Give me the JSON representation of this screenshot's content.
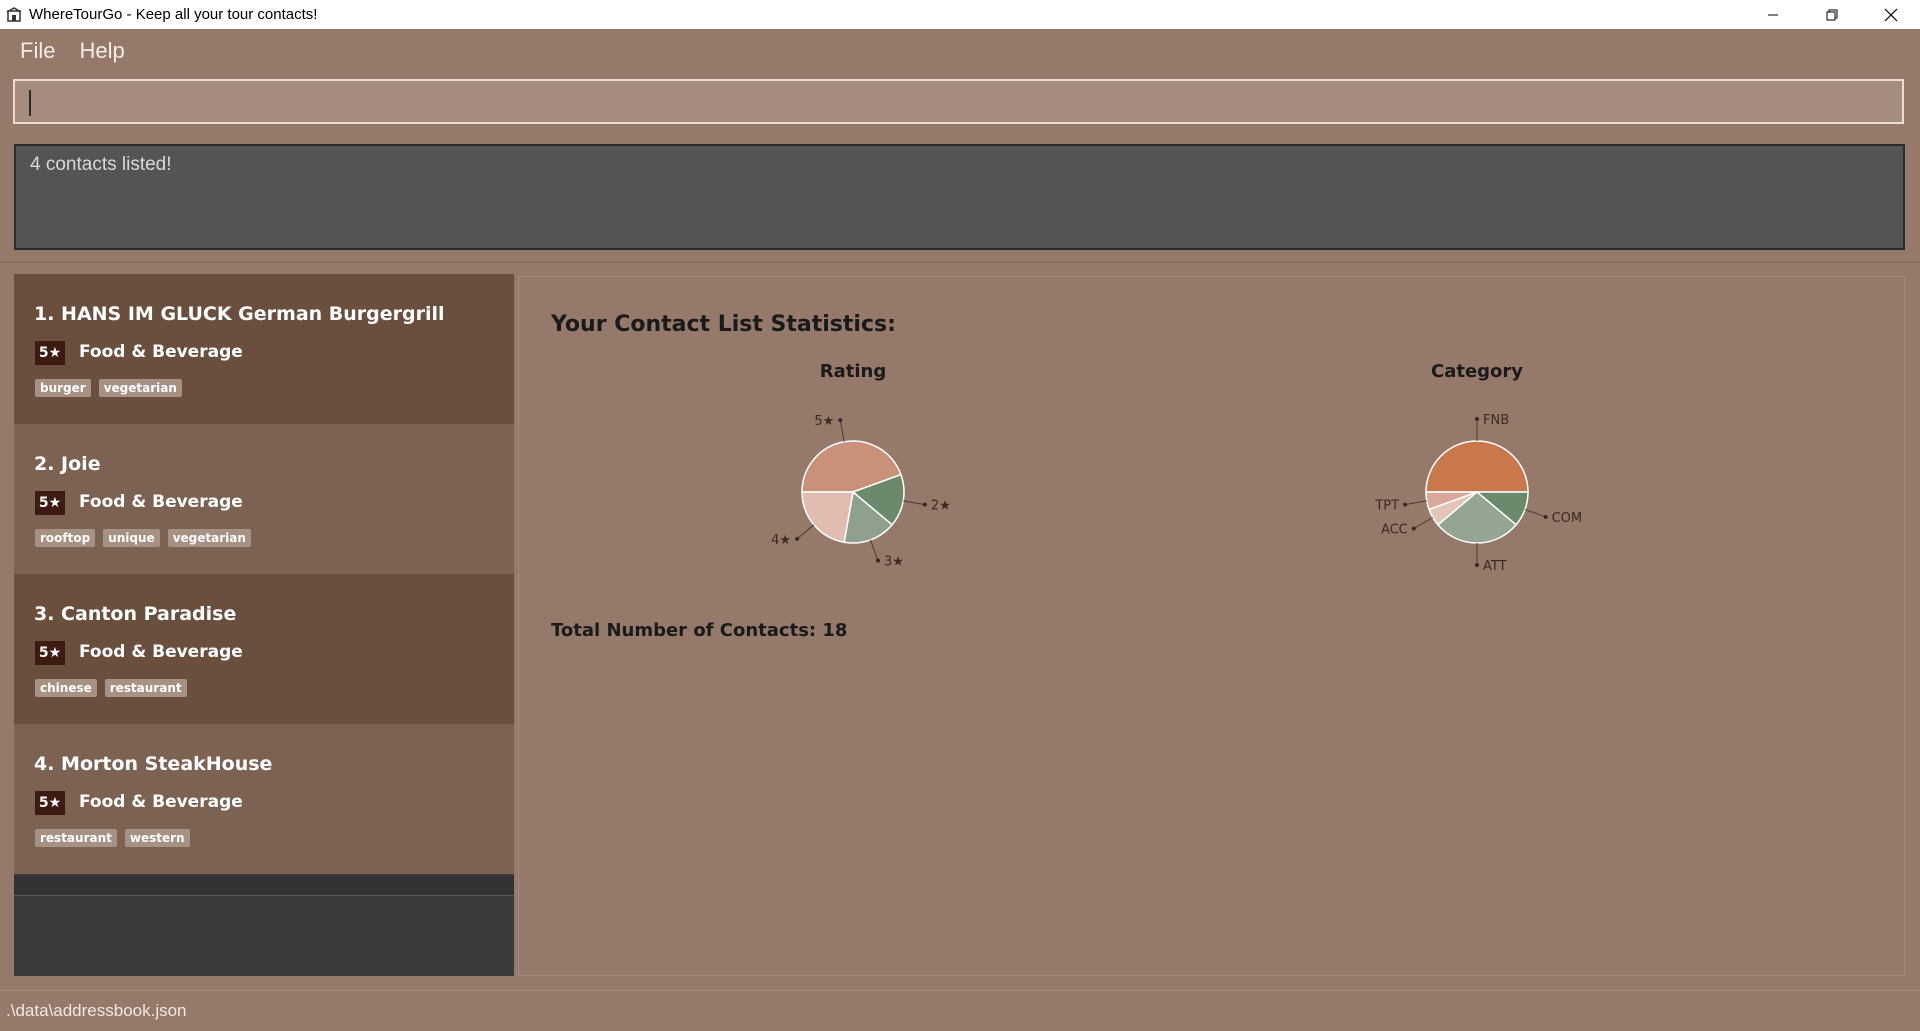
{
  "window": {
    "title": "WhereTourGo - Keep all your tour contacts!",
    "icons": {
      "app": "app-icon",
      "minimize": "minimize-icon",
      "maximize": "restore-icon",
      "close": "close-icon"
    }
  },
  "menu": {
    "file": "File",
    "help": "Help"
  },
  "command": {
    "value": "",
    "placeholder": ""
  },
  "result": {
    "message": "4 contacts listed!"
  },
  "contacts": [
    {
      "title": "1.  HANS IM GLUCK German Burgergrill",
      "rating": "5★",
      "category": "Food & Beverage",
      "tags": [
        "burger",
        "vegetarian"
      ]
    },
    {
      "title": "2.  Joie",
      "rating": "5★",
      "category": "Food & Beverage",
      "tags": [
        "rooftop",
        "unique",
        "vegetarian"
      ]
    },
    {
      "title": "3.  Canton Paradise",
      "rating": "5★",
      "category": "Food & Beverage",
      "tags": [
        "chinese",
        "restaurant"
      ]
    },
    {
      "title": "4.  Morton SteakHouse",
      "rating": "5★",
      "category": "Food & Beverage",
      "tags": [
        "restaurant",
        "western"
      ]
    }
  ],
  "stats": {
    "heading": "Your Contact List Statistics:",
    "total_label": "Total Number of Contacts: 18"
  },
  "chart_data": [
    {
      "type": "pie",
      "title": "Rating",
      "labels": [
        "5★",
        "2★",
        "3★",
        "4★"
      ],
      "values": [
        8,
        3,
        3,
        4
      ],
      "colors": [
        "#c9907a",
        "#6b8a6b",
        "#8fa08e",
        "#e0bdb0"
      ]
    },
    {
      "type": "pie",
      "title": "Category",
      "labels": [
        "FNB",
        "COM",
        "ATT",
        "ACC",
        "TPT"
      ],
      "values": [
        9,
        2,
        5,
        1,
        1
      ],
      "colors": [
        "#c8784a",
        "#6b8a6b",
        "#94a693",
        "#e3c5b8",
        "#d9a89a"
      ]
    }
  ],
  "status": {
    "path": ".\\data\\addressbook.json"
  }
}
